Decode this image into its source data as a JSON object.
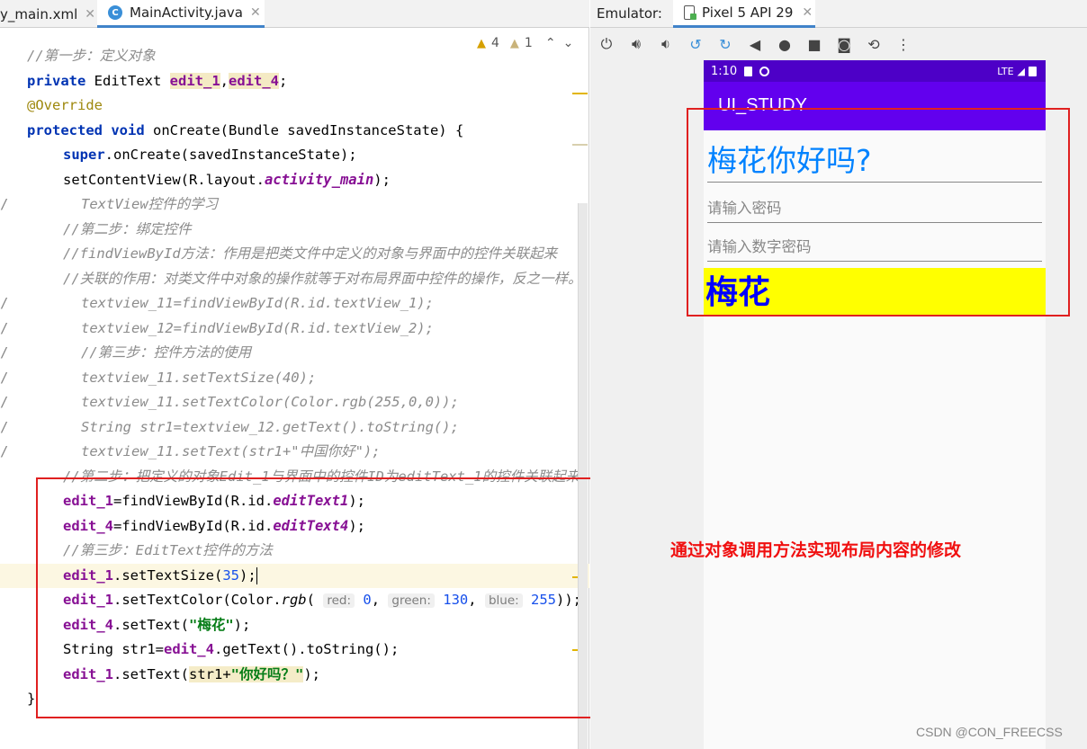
{
  "editor": {
    "tabs": [
      {
        "label": "y_main.xml",
        "close": "✕"
      },
      {
        "label": "MainActivity.java",
        "close": "✕"
      }
    ],
    "inspections": {
      "warnings": "4",
      "weak_warnings": "1"
    },
    "code": {
      "l1": "//第一步：定义对象",
      "l2_kw": "private",
      "l2_type": " EditText ",
      "l2_f1": "edit_1",
      "l2_comma": ",",
      "l2_f2": "edit_4",
      "l2_end": ";",
      "l3": "@Override",
      "l4_kw1": "protected",
      "l4_kw2": "void",
      "l4_rest": " onCreate(Bundle savedInstanceState) {",
      "l5_kw": "super",
      "l5_rest": ".onCreate(savedInstanceState);",
      "l6_a": "setContentView(R.layout.",
      "l6_b": "activity_main",
      "l6_c": ");",
      "l7": "TextView控件的学习",
      "l8": "//第二步：绑定控件",
      "l9": "//findViewById方法：作用是把类文件中定义的对象与界面中的控件关联起来",
      "l10": "//关联的作用：对类文件中对象的操作就等于对布局界面中控件的操作，反之一样。",
      "l11": "textview_11=findViewById(R.id.textView_1);",
      "l12": "textview_12=findViewById(R.id.textView_2);",
      "l13": "//第三步：控件方法的使用",
      "l14": "textview_11.setTextSize(40);",
      "l15": "textview_11.setTextColor(Color.rgb(255,0,0));",
      "l16": "String str1=textview_12.getText().toString();",
      "l17": "textview_11.setText(str1+\"中国你好\");",
      "l18": "//第二步：把定义的对象Edit_1与界面中的控件ID为editText_1的控件关联起来",
      "l19_f": "edit_1",
      "l19_a": "=findViewById(R.id.",
      "l19_b": "editText1",
      "l19_c": ");",
      "l20_f": "edit_4",
      "l20_a": "=findViewById(R.id.",
      "l20_b": "editText4",
      "l20_c": ");",
      "l21": "//第三步：EditText控件的方法",
      "l22_f": "edit_1",
      "l22_a": ".setTextSize(",
      "l22_n": "35",
      "l22_c": ");",
      "l23_f": "edit_1",
      "l23_a": ".setTextColor(Color.",
      "l23_m": "rgb",
      "l23_p": "(",
      "l23_h1": "red:",
      "l23_n1": "0",
      "l23_h2": "green:",
      "l23_n2": "130",
      "l23_h3": "blue:",
      "l23_n3": "255",
      "l23_c": "));",
      "l24_f": "edit_4",
      "l24_a": ".setText(",
      "l24_s": "\"梅花\"",
      "l24_c": ");",
      "l25_a": "String str1=",
      "l25_f": "edit_4",
      "l25_b": ".getText().toString();",
      "l26_f": "edit_1",
      "l26_a": ".setText(",
      "l26_h": "str1+",
      "l26_s": "\"你好吗？\"",
      "l26_c": ");",
      "l27": "}",
      "slash": "/"
    }
  },
  "emulator": {
    "label": "Emulator:",
    "device_tab": "Pixel 5 API 29",
    "close": "✕",
    "phone": {
      "time": "1:10",
      "network": "LTE",
      "app_title": "UI_STUDY",
      "edit1_text": "梅花你好吗?",
      "password_hint": "请输入密码",
      "numeric_password_hint": "请输入数字密码",
      "edit4_text": "梅花"
    }
  },
  "annotation": "通过对象调用方法实现布局内容的修改",
  "credit": "CSDN @CON_FREECSS",
  "colors": {
    "accent": "#4083c9",
    "statusbar": "#4d00c7",
    "appbar": "#6200ee",
    "edit1_text": "#0082ff",
    "edit4_bg": "#ffff00",
    "edit4_text": "#0000ff",
    "annotation": "#f01010"
  }
}
